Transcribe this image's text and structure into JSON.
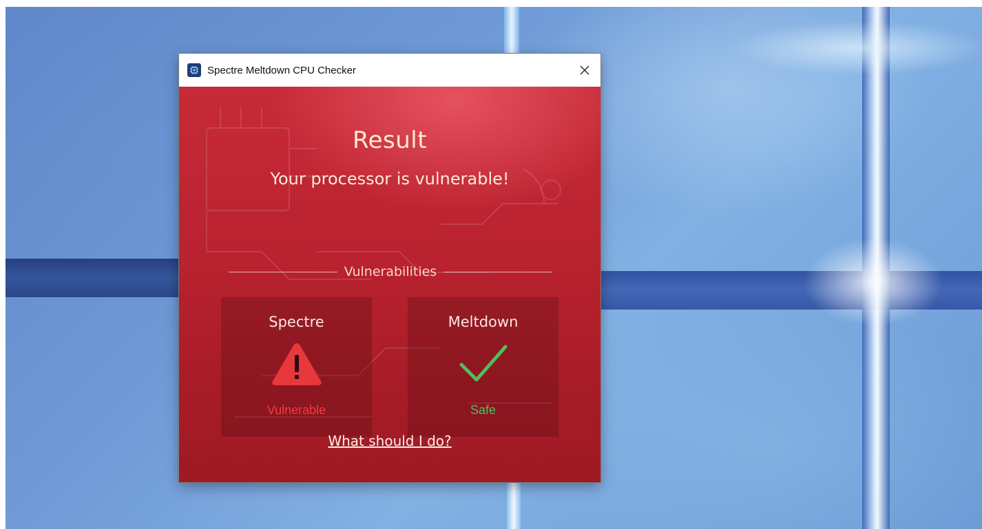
{
  "window": {
    "title": "Spectre Meltdown CPU Checker",
    "icon": "cpu-chip-icon",
    "close_icon": "close-icon"
  },
  "result": {
    "heading": "Result",
    "message": "Your processor is vulnerable!"
  },
  "section": {
    "label": "Vulnerabilities"
  },
  "vulnerabilities": [
    {
      "name": "Spectre",
      "status": "Vulnerable",
      "icon": "warning-triangle-icon",
      "status_color": "#f43a43"
    },
    {
      "name": "Meltdown",
      "status": "Safe",
      "icon": "checkmark-icon",
      "status_color": "#4fbf5c"
    }
  ],
  "help_link": "What should I do?",
  "colors": {
    "accent_red": "#b9222f",
    "warning_red": "#e53a3a",
    "safe_green": "#4fbf5c"
  }
}
